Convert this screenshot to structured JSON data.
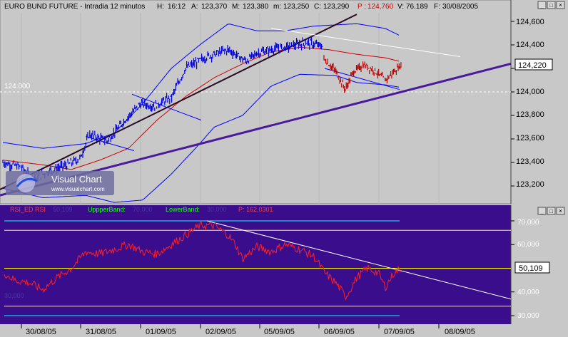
{
  "header": {
    "title": "EURO BUND FUTURE - Intradia 12 minutos",
    "h_label": "H:",
    "h_value": "16:12",
    "a_label": "A:",
    "a_value": "123,370",
    "m_label": "M:",
    "m_value": "123,380",
    "lo_label": "m:",
    "lo_value": "123,250",
    "c_label": "C:",
    "c_value": "123,290",
    "p_label": "P :",
    "p_value": "124,760",
    "v_label": "V:",
    "v_value": "76.189",
    "f_label": "F:",
    "f_value": "30/08/2005"
  },
  "price_panel": {
    "last_price": "124,220",
    "level_label": "124.000",
    "y_ticks": [
      "124,600",
      "124,400",
      "124,200",
      "124,000",
      "123,800",
      "123,600",
      "123,400",
      "123,200"
    ]
  },
  "rsi_panel": {
    "legend_rsi": "RSI_ED  RSI",
    "legend_rsi_val": "50,109",
    "legend_upper": "UppperBand:",
    "legend_upper_val": "70,000",
    "legend_lower": "LowerBand:",
    "legend_lower_val": "30,000",
    "legend_p": "P: 162,0301",
    "last_value": "50,109",
    "y_ticks": [
      "70,000",
      "60,000",
      "40,000",
      "30,000"
    ],
    "low_label": "30,000"
  },
  "x_axis": {
    "dates": [
      "30/08/05",
      "31/08/05",
      "01/09/05",
      "02/09/05",
      "05/09/05",
      "06/09/05",
      "07/09/05",
      "08/09/05"
    ]
  },
  "watermark": {
    "brand": "Visual Chart",
    "url": "www.visualchart.com"
  },
  "window_buttons": [
    "_",
    "□",
    "×"
  ],
  "colors": {
    "price_bg": "#c8c8c8",
    "rsi_bg": "#3a0d8c",
    "price_bars": "#0000e0",
    "recent_bars": "#c00000",
    "bollinger": "#0000ff",
    "moving_avg": "#d00000",
    "trend_dark": "#2a0a20",
    "trend_purple": "#4a1a9c",
    "rsi_line": "#ff2020",
    "rsi_band": "#ffff00",
    "rsi_outer": "#00ffff"
  },
  "chart_data": [
    {
      "type": "line",
      "ylim": [
        123120,
        124680
      ],
      "close_series": [
        {
          "x": "30/08/05",
          "y": 123440
        },
        {
          "x": "31/08/05",
          "y": 123620
        },
        {
          "x": "01/09/05",
          "y": 123920
        },
        {
          "x": "02/09/05",
          "y": 124340
        },
        {
          "x": "05/09/05",
          "y": 124380
        },
        {
          "x": "06/09/05",
          "y": 124140
        },
        {
          "x": "07/09/05",
          "y": 124220
        }
      ],
      "bollinger_upper_end": 124560,
      "bollinger_lower_end": 124040,
      "moving_average_end": 124260
    },
    {
      "type": "line",
      "ylim": [
        25,
        75
      ],
      "bands": [
        70,
        60,
        40,
        30
      ],
      "rsi": [
        {
          "x": "30/08/05",
          "y": 45
        },
        {
          "x": "31/08/05",
          "y": 57
        },
        {
          "x": "01/09/05",
          "y": 60
        },
        {
          "x": "02/09/05",
          "y": 69
        },
        {
          "x": "05/09/05",
          "y": 59
        },
        {
          "x": "06/09/05",
          "y": 40
        },
        {
          "x": "07/09/05",
          "y": 50.1
        }
      ]
    }
  ]
}
